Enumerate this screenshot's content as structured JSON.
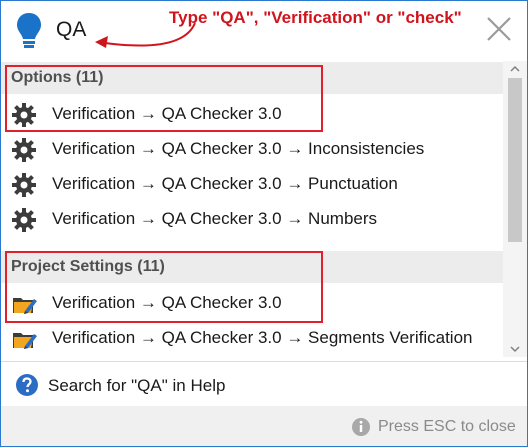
{
  "search": {
    "query": "QA"
  },
  "annotation": {
    "hint": "Type \"QA\", \"Verification\" or \"check\""
  },
  "sections": [
    {
      "title": "Options (11)",
      "items": [
        {
          "label": "Verification → QA Checker 3.0",
          "icon": "gear-icon"
        },
        {
          "label": "Verification → QA Checker 3.0 → Inconsistencies",
          "icon": "gear-icon"
        },
        {
          "label": "Verification → QA Checker 3.0 → Punctuation",
          "icon": "gear-icon"
        },
        {
          "label": "Verification → QA Checker 3.0 → Numbers",
          "icon": "gear-icon"
        }
      ]
    },
    {
      "title": "Project Settings (11)",
      "items": [
        {
          "label": "Verification → QA Checker 3.0",
          "icon": "project-settings-icon"
        },
        {
          "label": "Verification → QA Checker 3.0 → Segments Verification",
          "icon": "project-settings-icon"
        }
      ]
    }
  ],
  "help": {
    "label": "Search for \"QA\" in Help",
    "icon": "help-icon"
  },
  "footer": {
    "text": "Press ESC to close",
    "icon": "info-icon"
  },
  "colors": {
    "accent": "#1a73c8",
    "annotation": "#d0141c",
    "section_bg": "#ececec"
  }
}
